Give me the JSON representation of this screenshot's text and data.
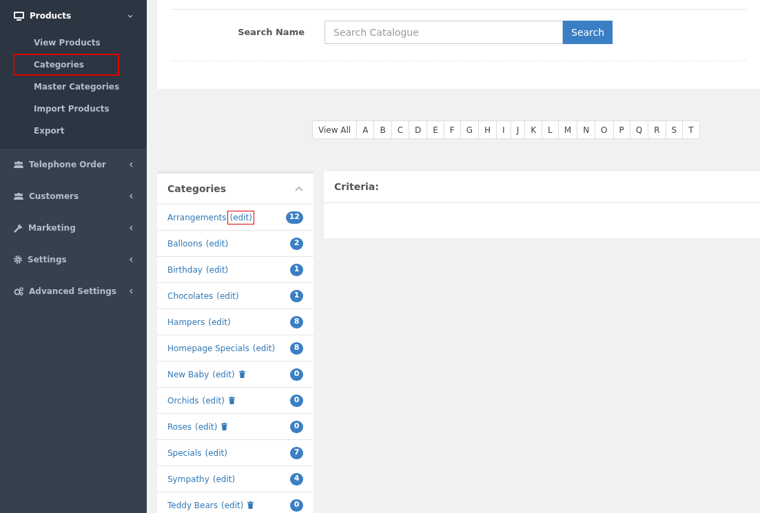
{
  "sidebar": {
    "items": [
      {
        "label": "Products",
        "expanded": true,
        "children": [
          {
            "label": "View Products",
            "highlighted": false
          },
          {
            "label": "Categories",
            "highlighted": true
          },
          {
            "label": "Master Categories",
            "highlighted": false
          },
          {
            "label": "Import Products",
            "highlighted": false
          },
          {
            "label": "Export",
            "highlighted": false
          }
        ]
      },
      {
        "label": "Telephone Order",
        "expanded": false
      },
      {
        "label": "Customers",
        "expanded": false
      },
      {
        "label": "Marketing",
        "expanded": false
      },
      {
        "label": "Settings",
        "expanded": false
      },
      {
        "label": "Advanced Settings",
        "expanded": false
      }
    ]
  },
  "search": {
    "label": "Search Name",
    "placeholder": "Search Catalogue",
    "button": "Search"
  },
  "letters": [
    "View All",
    "A",
    "B",
    "C",
    "D",
    "E",
    "F",
    "G",
    "H",
    "I",
    "J",
    "K",
    "L",
    "M",
    "N",
    "O",
    "P",
    "Q",
    "R",
    "S",
    "T"
  ],
  "categories": {
    "title": "Categories",
    "items": [
      {
        "name": "Arrangements",
        "edit": "(edit)",
        "edit_highlighted": true,
        "deletable": false,
        "count": "12"
      },
      {
        "name": "Balloons",
        "edit": "(edit)",
        "edit_highlighted": false,
        "deletable": false,
        "count": "2"
      },
      {
        "name": "Birthday",
        "edit": "(edit)",
        "edit_highlighted": false,
        "deletable": false,
        "count": "1"
      },
      {
        "name": "Chocolates",
        "edit": "(edit)",
        "edit_highlighted": false,
        "deletable": false,
        "count": "1"
      },
      {
        "name": "Hampers",
        "edit": "(edit)",
        "edit_highlighted": false,
        "deletable": false,
        "count": "8"
      },
      {
        "name": "Homepage Specials",
        "edit": "(edit)",
        "edit_highlighted": false,
        "deletable": false,
        "count": "8"
      },
      {
        "name": "New Baby",
        "edit": "(edit)",
        "edit_highlighted": false,
        "deletable": true,
        "count": "0"
      },
      {
        "name": "Orchids",
        "edit": "(edit)",
        "edit_highlighted": false,
        "deletable": true,
        "count": "0"
      },
      {
        "name": "Roses",
        "edit": "(edit)",
        "edit_highlighted": false,
        "deletable": true,
        "count": "0"
      },
      {
        "name": "Specials",
        "edit": "(edit)",
        "edit_highlighted": false,
        "deletable": false,
        "count": "7"
      },
      {
        "name": "Sympathy",
        "edit": "(edit)",
        "edit_highlighted": false,
        "deletable": false,
        "count": "4"
      },
      {
        "name": "Teddy Bears",
        "edit": "(edit)",
        "edit_highlighted": false,
        "deletable": true,
        "count": "0"
      }
    ]
  },
  "criteria": {
    "title": "Criteria:"
  }
}
